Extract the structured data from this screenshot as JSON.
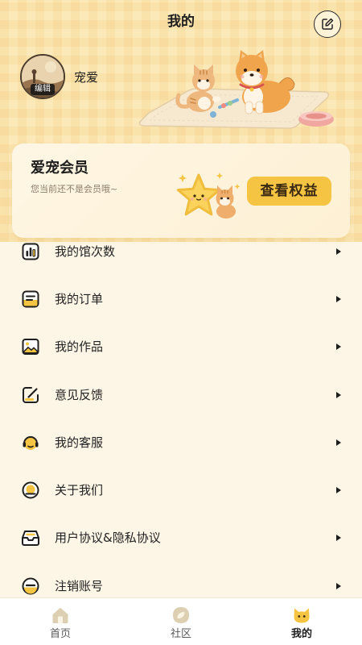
{
  "header": {
    "title": "我的",
    "edit_icon": "edit-icon"
  },
  "profile": {
    "avatar_badge": "编辑",
    "username": "宠爱"
  },
  "membership": {
    "title": "爱宠会员",
    "subtitle": "您当前还不是会员哦~",
    "button_label": "查看权益"
  },
  "menu": [
    {
      "label": "我的馆次数",
      "icon": "bar-chart-icon"
    },
    {
      "label": "我的订单",
      "icon": "order-icon"
    },
    {
      "label": "我的作品",
      "icon": "image-icon"
    },
    {
      "label": "意见反馈",
      "icon": "feedback-icon"
    },
    {
      "label": "我的客服",
      "icon": "headset-icon"
    },
    {
      "label": "关于我们",
      "icon": "about-icon"
    },
    {
      "label": "用户协议&隐私协议",
      "icon": "inbox-icon"
    },
    {
      "label": "注销账号",
      "icon": "cancel-account-icon"
    }
  ],
  "tabbar": [
    {
      "label": "首页",
      "icon": "home-icon",
      "active": false
    },
    {
      "label": "社区",
      "icon": "community-icon",
      "active": false
    },
    {
      "label": "我的",
      "icon": "cat-icon",
      "active": true
    }
  ],
  "colors": {
    "accent": "#F5C443",
    "header_bg": "#FCE9BA",
    "page_bg": "#FDF6E6",
    "text": "#1E1E1E"
  }
}
